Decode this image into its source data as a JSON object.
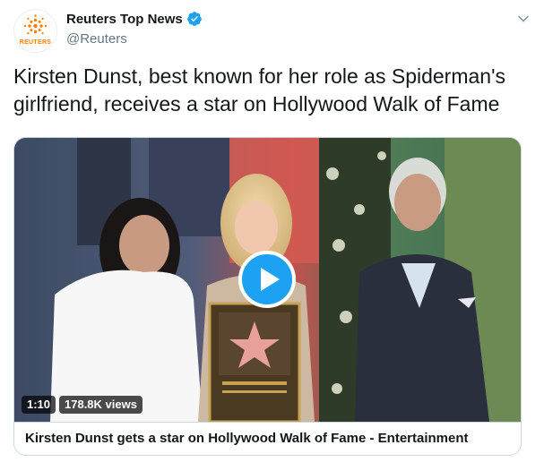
{
  "author": {
    "display_name": "Reuters Top News",
    "handle": "@Reuters",
    "avatar_label": "REUTERS",
    "verified": true
  },
  "tweet": {
    "text": "Kirsten Dunst, best known for her role as Spiderman's girlfriend, receives a star on Hollywood Walk of Fame"
  },
  "media": {
    "duration": "1:10",
    "views": "178.8K views",
    "card_title": "Kirsten Dunst gets a star on Hollywood Walk of Fame - Entertainment"
  },
  "colors": {
    "accent": "#1da1f2",
    "brand_orange": "#ff8000",
    "text": "#14171a",
    "secondary_text": "#657786"
  },
  "icons": [
    "reuters-logo-icon",
    "verified-badge-icon",
    "chevron-down-icon",
    "play-icon"
  ]
}
